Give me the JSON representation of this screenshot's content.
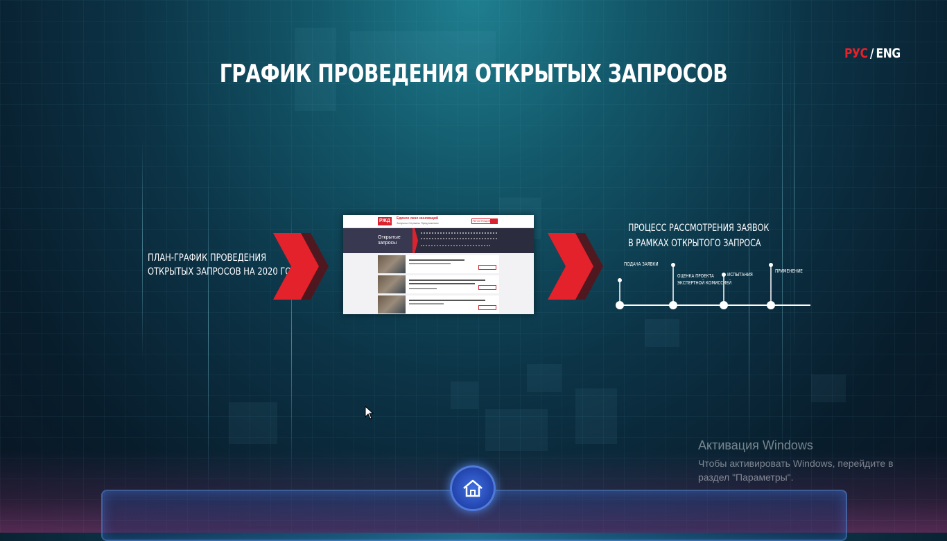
{
  "language": {
    "rus": "РУС",
    "separator": "/",
    "eng": "ENG"
  },
  "title": "ГРАФИК ПРОВЕДЕНИЯ ОТКРЫТЫХ ЗАПРОСОВ",
  "left_block": {
    "line1": "ПЛАН-ГРАФИК ПРОВЕДЕНИЯ",
    "line2": "ОТКРЫТЫХ ЗАПРОСОВ НА 2020 ГОД"
  },
  "screenshot": {
    "logo": "РЖД",
    "site_title": "Единое окно инноваций",
    "nav": "Запросы  Сервисы  Предложения",
    "button": "РЕГИСТРАЦИЯ",
    "banner_title_line1": "Открытые",
    "banner_title_line2": "запросы"
  },
  "right_block": {
    "line1": "ПРОЦЕСС РАССМОТРЕНИЯ ЗАЯВОК",
    "line2": "В РАМКАХ ОТКРЫТОГО ЗАПРОСА"
  },
  "timeline": {
    "steps": [
      {
        "label": "ПОДАЧА ЗАЯВКИ"
      },
      {
        "label_line1": "ОЦЕНКА ПРОЕКТА",
        "label_line2": "ЭКСПЕРТНОЙ КОМИССИЕЙ"
      },
      {
        "label": "ИСПЫТАНИЯ"
      },
      {
        "label": "ПРИМЕНЕНИЕ"
      }
    ]
  },
  "windows_activation": {
    "title": "Активация Windows",
    "text": "Чтобы активировать Windows, перейдите в раздел \"Параметры\"."
  },
  "colors": {
    "accent_red": "#e8202a",
    "home_button": "#2a4fc0"
  },
  "icons": {
    "home": "home-icon",
    "chevron": "double-chevron-right-icon"
  }
}
